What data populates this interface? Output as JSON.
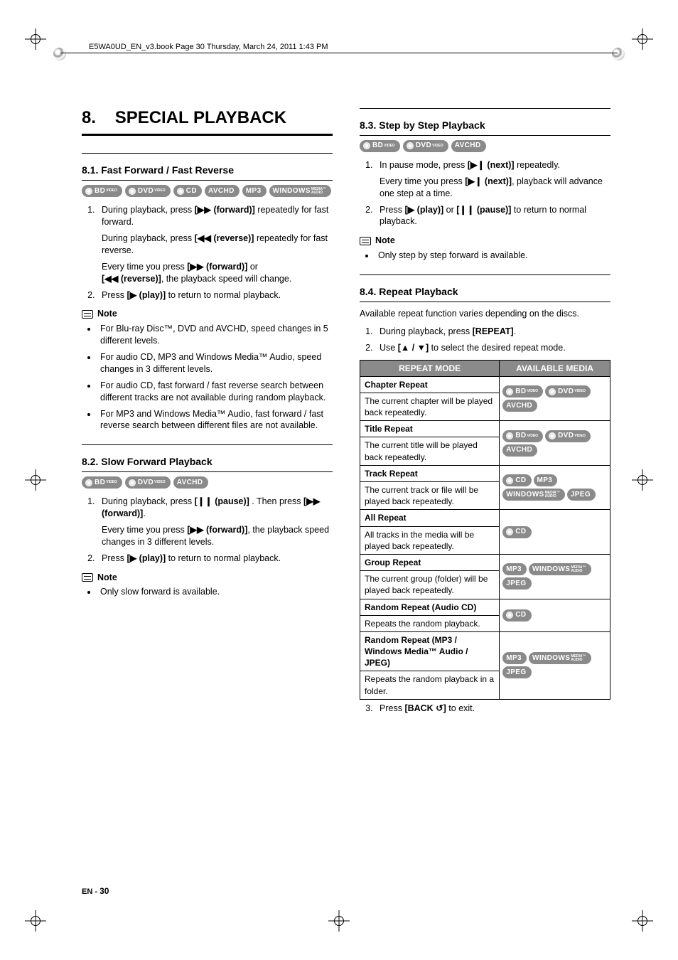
{
  "header_line": "E5WA0UD_EN_v3.book  Page 30  Thursday, March 24, 2011  1:43 PM",
  "chapter": {
    "num": "8.",
    "title": "SPECIAL PLAYBACK"
  },
  "badges": {
    "bd": {
      "main": "BD",
      "sub": "VIDEO",
      "disc": true
    },
    "dvd": {
      "main": "DVD",
      "sub": "VIDEO",
      "disc": true
    },
    "cd": {
      "main": "CD",
      "sub": "",
      "disc": true
    },
    "avchd": {
      "main": "AVCHD",
      "sub": "",
      "disc": false
    },
    "mp3": {
      "main": "MP3",
      "sub": "",
      "disc": false
    },
    "wma": {
      "main": "WINDOWS",
      "sub": "MEDIA™\nAUDIO",
      "disc": false,
      "twoline": true
    },
    "jpeg": {
      "main": "JPEG",
      "sub": "",
      "disc": false
    }
  },
  "s81": {
    "title": "8.1.   Fast Forward / Fast Reverse",
    "badges": [
      "bd",
      "dvd",
      "cd",
      "avchd",
      "mp3",
      "wma"
    ],
    "steps": [
      {
        "body": "During playback, press [▶▶ (forward)] repeatedly for fast forward.",
        "extra1": "During playback, press [◀◀ (reverse)] repeatedly for fast reverse.",
        "extra2": "Every time you press [▶▶ (forward)] or ",
        "extra3": "[◀◀ (reverse)], the playback speed will change."
      },
      {
        "body": "Press [▶ (play)] to return to normal playback."
      }
    ],
    "note_label": "Note",
    "notes": [
      "For Blu-ray Disc™, DVD and AVCHD, speed changes in 5 different levels.",
      "For audio CD, MP3 and Windows Media™ Audio, speed changes in 3 different levels.",
      "For audio CD, fast forward / fast reverse search between different tracks are not available during random playback.",
      "For MP3 and Windows Media™ Audio, fast forward / fast reverse search between different files are not available."
    ]
  },
  "s82": {
    "title": "8.2.   Slow Forward Playback",
    "badges": [
      "bd",
      "dvd",
      "avchd"
    ],
    "steps": [
      {
        "body": "During playback, press [❙❙ (pause)] . Then press [▶▶ (forward)].",
        "extra1": "Every time you press [▶▶ (forward)], the playback speed changes in 3 different levels."
      },
      {
        "body": "Press [▶ (play)] to return to normal playback."
      }
    ],
    "note_label": "Note",
    "notes": [
      "Only slow forward is available."
    ]
  },
  "s83": {
    "title": "8.3.   Step by Step Playback",
    "badges": [
      "bd",
      "dvd",
      "avchd"
    ],
    "steps": [
      {
        "body": "In pause mode, press [▶❙ (next)] repeatedly.",
        "extra1": "Every time you press [▶❙ (next)], playback will advance one step at a time."
      },
      {
        "body": "Press [▶ (play)] or [❙❙ (pause)] to return to normal playback."
      }
    ],
    "note_label": "Note",
    "notes": [
      "Only step by step forward is available."
    ]
  },
  "s84": {
    "title": "8.4.   Repeat Playback",
    "intro": "Available repeat function varies depending on the discs.",
    "steps_a": [
      "During playback, press [REPEAT].",
      "Use [▲ / ▼] to select the desired repeat mode."
    ],
    "table": {
      "headers": [
        "REPEAT MODE",
        "AVAILABLE MEDIA"
      ],
      "rows": [
        {
          "head": "Chapter Repeat",
          "desc": "The current chapter will be played back repeatedly.",
          "media": [
            "bd",
            "dvd",
            "avchd"
          ]
        },
        {
          "head": "Title Repeat",
          "desc": "The current title will be played back repeatedly.",
          "media": [
            "bd",
            "dvd",
            "avchd"
          ]
        },
        {
          "head": "Track Repeat",
          "desc": "The current track or file will be played back repeatedly.",
          "media": [
            "cd",
            "mp3",
            "wma",
            "jpeg"
          ]
        },
        {
          "head": "All Repeat",
          "desc": "All tracks in the media will be played back repeatedly.",
          "media": [
            "cd"
          ]
        },
        {
          "head": "Group Repeat",
          "desc": "The current group (folder) will be played back repeatedly.",
          "media": [
            "mp3",
            "wma",
            "jpeg"
          ]
        },
        {
          "head": "Random Repeat (Audio CD)",
          "desc": "Repeats the random playback.",
          "media": [
            "cd"
          ]
        },
        {
          "head": "Random Repeat (MP3 / Windows Media™ Audio / JPEG)",
          "desc": "Repeats the random playback in a folder.",
          "media": [
            "mp3",
            "wma",
            "jpeg"
          ]
        }
      ]
    },
    "step3": "Press [BACK ↺] to exit."
  },
  "footer": {
    "lang": "EN",
    "sep": " - ",
    "page": "30"
  }
}
